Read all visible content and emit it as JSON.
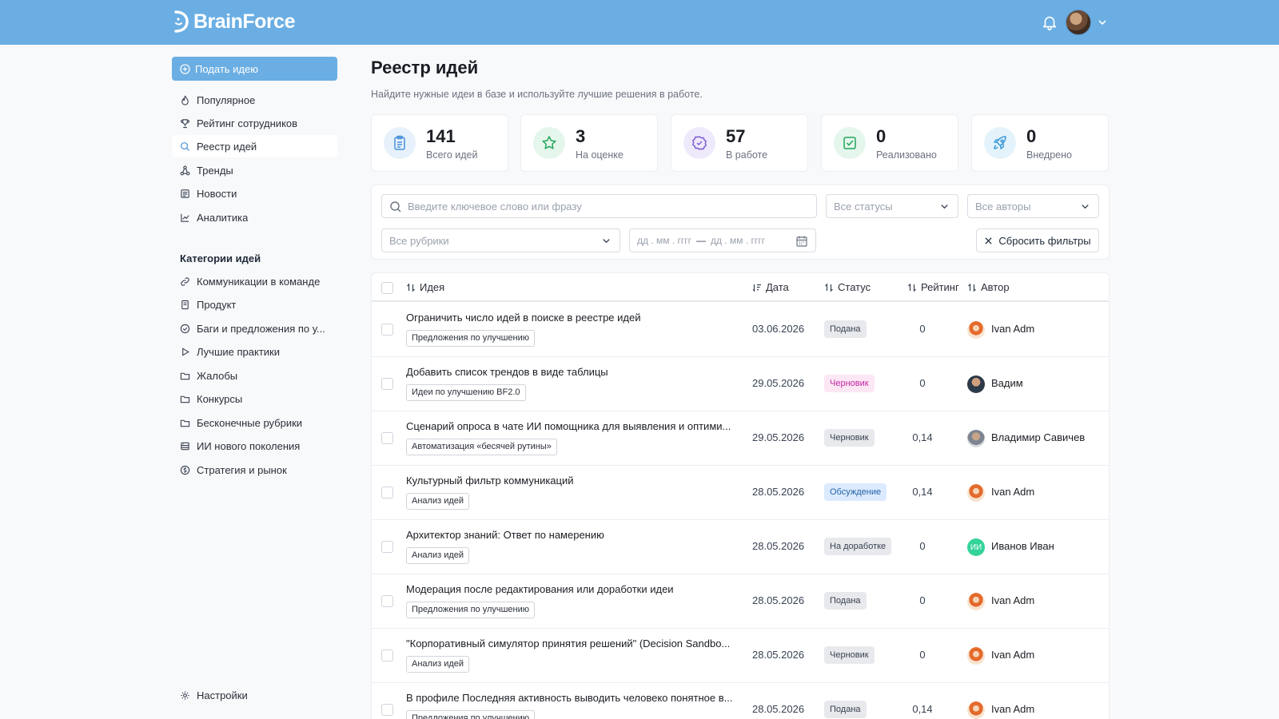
{
  "header": {
    "logo_text": "BrainForce"
  },
  "sidebar": {
    "submit_label": "Подать идею",
    "items": [
      {
        "label": "Популярное",
        "icon": "flame-icon"
      },
      {
        "label": "Рейтинг сотрудников",
        "icon": "trophy-icon"
      },
      {
        "label": "Реестр идей",
        "icon": "search-icon"
      },
      {
        "label": "Тренды",
        "icon": "network-icon"
      },
      {
        "label": "Новости",
        "icon": "newspaper-icon"
      },
      {
        "label": "Аналитика",
        "icon": "chart-line-icon"
      }
    ],
    "categories_title": "Категории идей",
    "categories": [
      {
        "label": "Коммуникации в команде",
        "icon": "link-icon"
      },
      {
        "label": "Продукт",
        "icon": "book-icon"
      },
      {
        "label": "Баги и предложения по у...",
        "icon": "check-circle-icon"
      },
      {
        "label": "Лучшие практики",
        "icon": "play-icon"
      },
      {
        "label": "Жалобы",
        "icon": "folder-icon"
      },
      {
        "label": "Конкурсы",
        "icon": "folder-icon"
      },
      {
        "label": "Бесконечные рубрики",
        "icon": "folder-icon"
      },
      {
        "label": "ИИ нового поколения",
        "icon": "server-icon"
      },
      {
        "label": "Стратегия и рынок",
        "icon": "coin-icon"
      }
    ],
    "settings_label": "Настройки"
  },
  "main": {
    "title": "Реестр идей",
    "subtitle": "Найдите нужные идеи в базе и используйте лучшие решения в работе.",
    "stats": [
      {
        "value": "141",
        "label": "Всего идей",
        "icon": "clipboard-icon",
        "color": "#4a90d9",
        "bg": "#e6f1fb"
      },
      {
        "value": "3",
        "label": "На оценке",
        "icon": "star-icon",
        "color": "#22a55b",
        "bg": "#e5f6ec"
      },
      {
        "value": "57",
        "label": "В работе",
        "icon": "badge-check-icon",
        "color": "#7c5cd6",
        "bg": "#efeafb"
      },
      {
        "value": "0",
        "label": "Реализовано",
        "icon": "checkbox-icon",
        "color": "#22a55b",
        "bg": "#e5f6ec"
      },
      {
        "value": "0",
        "label": "Внедрено",
        "icon": "rocket-icon",
        "color": "#3b9bd9",
        "bg": "#e4f3fb"
      }
    ],
    "filters": {
      "search_placeholder": "Введите ключевое слово или фразу",
      "status": "Все статусы",
      "authors": "Все авторы",
      "rubrics": "Все рубрики",
      "date_from": "дд . мм .  гггг",
      "date_sep": "—",
      "date_to": "дд . мм .  гггг",
      "reset_label": "Сбросить фильтры"
    },
    "table": {
      "columns": [
        "Идея",
        "Дата",
        "Статус",
        "Рейтинг",
        "Автор"
      ],
      "rows": [
        {
          "title": "Ограничить число идей в поиске в реестре идей",
          "tag": "Предложения по улучшению",
          "date": "03.06.2026",
          "status": "Подана",
          "status_class": "st-submitted",
          "rating": "0",
          "author": "Ivan Adm",
          "av": "av-ivan"
        },
        {
          "title": "Добавить список трендов в виде таблицы",
          "tag": "Идеи по улучшению BF2.0",
          "date": "29.05.2026",
          "status": "Черновик",
          "status_class": "st-draft-pink",
          "rating": "0",
          "author": "Вадим",
          "av": "av-vadim"
        },
        {
          "title": "Сценарий опроса в чате ИИ помощника для выявления и оптими...",
          "tag": "Автоматизация «бесячей рутины»",
          "date": "29.05.2026",
          "status": "Черновик",
          "status_class": "st-draft",
          "rating": "0,14",
          "author": "Владимир Савичев",
          "av": "av-vlad"
        },
        {
          "title": "Культурный фильтр коммуникаций",
          "tag": "Анализ идей",
          "date": "28.05.2026",
          "status": "Обсуждение",
          "status_class": "st-discuss",
          "rating": "0,14",
          "author": "Ivan Adm",
          "av": "av-ivan"
        },
        {
          "title": "Архитектор знаний: Ответ по намерению",
          "tag": "Анализ идей",
          "date": "28.05.2026",
          "status": "На доработке",
          "status_class": "st-rework",
          "rating": "0",
          "author": "Иванов Иван",
          "av": "av-ii",
          "av_text": "ИИ"
        },
        {
          "title": "Модерация после редактирования или доработки идеи",
          "tag": "Предложения по улучшению",
          "date": "28.05.2026",
          "status": "Подана",
          "status_class": "st-submitted",
          "rating": "0",
          "author": "Ivan Adm",
          "av": "av-ivan"
        },
        {
          "title": "\"Корпоративный симулятор принятия решений\" (Decision Sandbo...",
          "tag": "Анализ идей",
          "date": "28.05.2026",
          "status": "Черновик",
          "status_class": "st-draft",
          "rating": "0",
          "author": "Ivan Adm",
          "av": "av-ivan"
        },
        {
          "title": "В профиле Последняя активность выводить человеко понятное в...",
          "tag": "Предложения по улучшению",
          "date": "28.05.2026",
          "status": "Подана",
          "status_class": "st-submitted",
          "rating": "0,14",
          "author": "Ivan Adm",
          "av": "av-ivan"
        }
      ]
    }
  }
}
